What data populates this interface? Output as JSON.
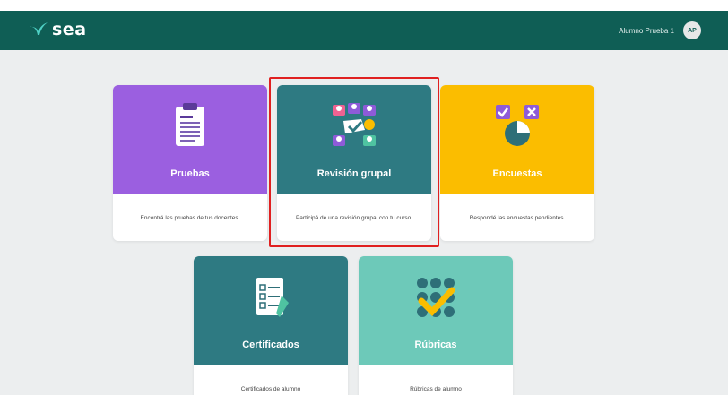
{
  "app": {
    "name": "sea"
  },
  "user": {
    "name": "Alumno Prueba 1",
    "initials": "AP"
  },
  "cards": [
    {
      "title": "Pruebas",
      "description": "Encontrá las pruebas de tus docentes.",
      "color": "#9b5fe0",
      "icon": "clipboard-icon"
    },
    {
      "title": "Revisión grupal",
      "description": "Participá de una revisión grupal con tu curso.",
      "color": "#2e7a82",
      "icon": "group-review-icon"
    },
    {
      "title": "Encuestas",
      "description": "Respondé las encuestas pendientes.",
      "color": "#fbbd00",
      "icon": "survey-chart-icon"
    },
    {
      "title": "Certificados",
      "description": "Certificados de alumno",
      "color": "#2e7a82",
      "icon": "certificate-icon"
    },
    {
      "title": "Rúbricas",
      "description": "Rúbricas de alumno",
      "color": "#6dc9b9",
      "icon": "rubric-icon"
    }
  ],
  "highlighted_card": "Revisión grupal"
}
